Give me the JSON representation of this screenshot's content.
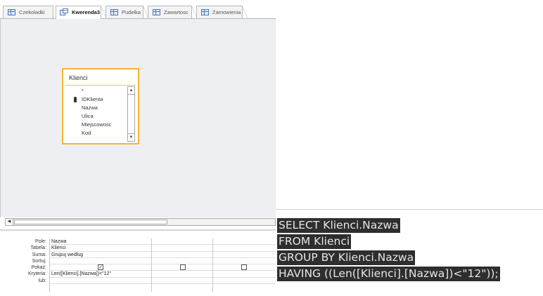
{
  "tabs": [
    {
      "label": "Czekoladki",
      "icon": "table-icon",
      "active": false
    },
    {
      "label": "Kwerenda3",
      "icon": "query-icon",
      "active": true
    },
    {
      "label": "Pudelka",
      "icon": "table-icon",
      "active": false
    },
    {
      "label": "Zawartosc",
      "icon": "table-icon",
      "active": false
    },
    {
      "label": "Zamowienia",
      "icon": "table-icon",
      "active": false
    }
  ],
  "field_list": {
    "title": "Klienci",
    "fields": [
      "*",
      "IDKlienta",
      "Nazwa",
      "Ulica",
      "Miejscowosc",
      "Kod"
    ],
    "primary_key": "IDKlienta"
  },
  "qbe": {
    "row_labels": {
      "pole": "Pole:",
      "tabela": "Tabela:",
      "suma": "Suma:",
      "sortuj": "Sortuj:",
      "pokaz": "Pokaż:",
      "kryteria": "Kryteria:",
      "lub": "lub:"
    },
    "column1": {
      "pole": "Nazwa",
      "tabela": "Klienci",
      "suma": "Grupuj według",
      "sortuj": "",
      "pokaz": true,
      "kryteria": "Len([Klienci].[Nazwa])<\"12\"",
      "lub": ""
    },
    "column2": {
      "pokaz": false
    },
    "column3": {
      "pokaz": false
    }
  },
  "sql": {
    "lines": [
      "SELECT Klienci.Nazwa",
      "FROM Klienci",
      "GROUP BY Klienci.Nazwa",
      "HAVING ((Len([Klienci].[Nazwa])<\"12\"));"
    ]
  },
  "colors": {
    "field_list_border": "#f4b735",
    "design_background": "#eeeff2",
    "sql_highlight": "#2e2e2e",
    "sql_text": "#e6e6e6"
  }
}
